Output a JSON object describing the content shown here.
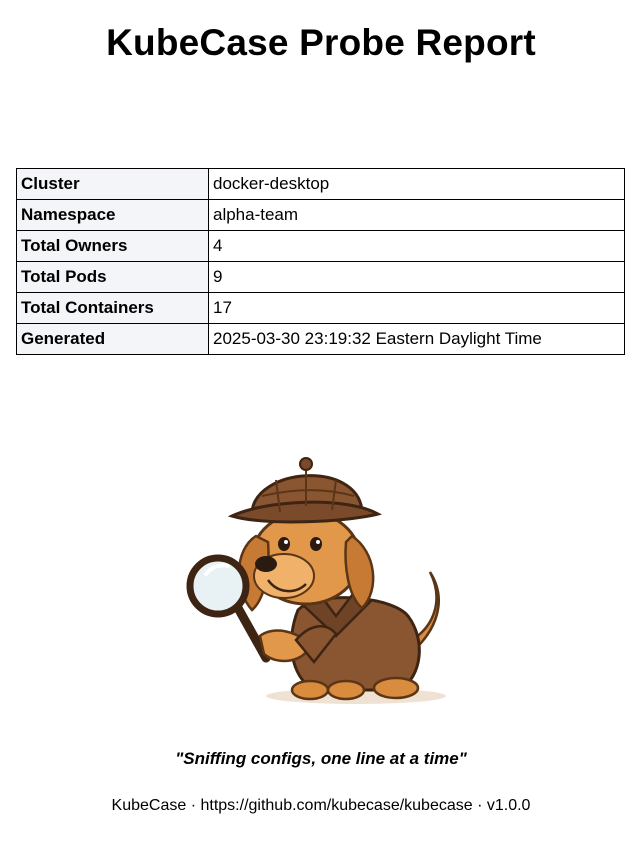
{
  "report": {
    "title": "KubeCase Probe Report"
  },
  "summary": {
    "rows": [
      {
        "label": "Cluster",
        "value": "docker-desktop"
      },
      {
        "label": "Namespace",
        "value": "alpha-team"
      },
      {
        "label": "Total Owners",
        "value": "4"
      },
      {
        "label": "Total Pods",
        "value": "9"
      },
      {
        "label": "Total Containers",
        "value": "17"
      },
      {
        "label": "Generated",
        "value": "2025-03-30 23:19:32 Eastern Daylight Time"
      }
    ]
  },
  "mascot": {
    "icon": "detective-dog-icon"
  },
  "tagline": "\"Sniffing configs, one line at a time\"",
  "footer": "KubeCase · https://github.com/kubecase/kubecase · v1.0.0",
  "colors": {
    "key_cell_bg": "#f4f5f9",
    "border": "#000000",
    "text": "#000000"
  }
}
